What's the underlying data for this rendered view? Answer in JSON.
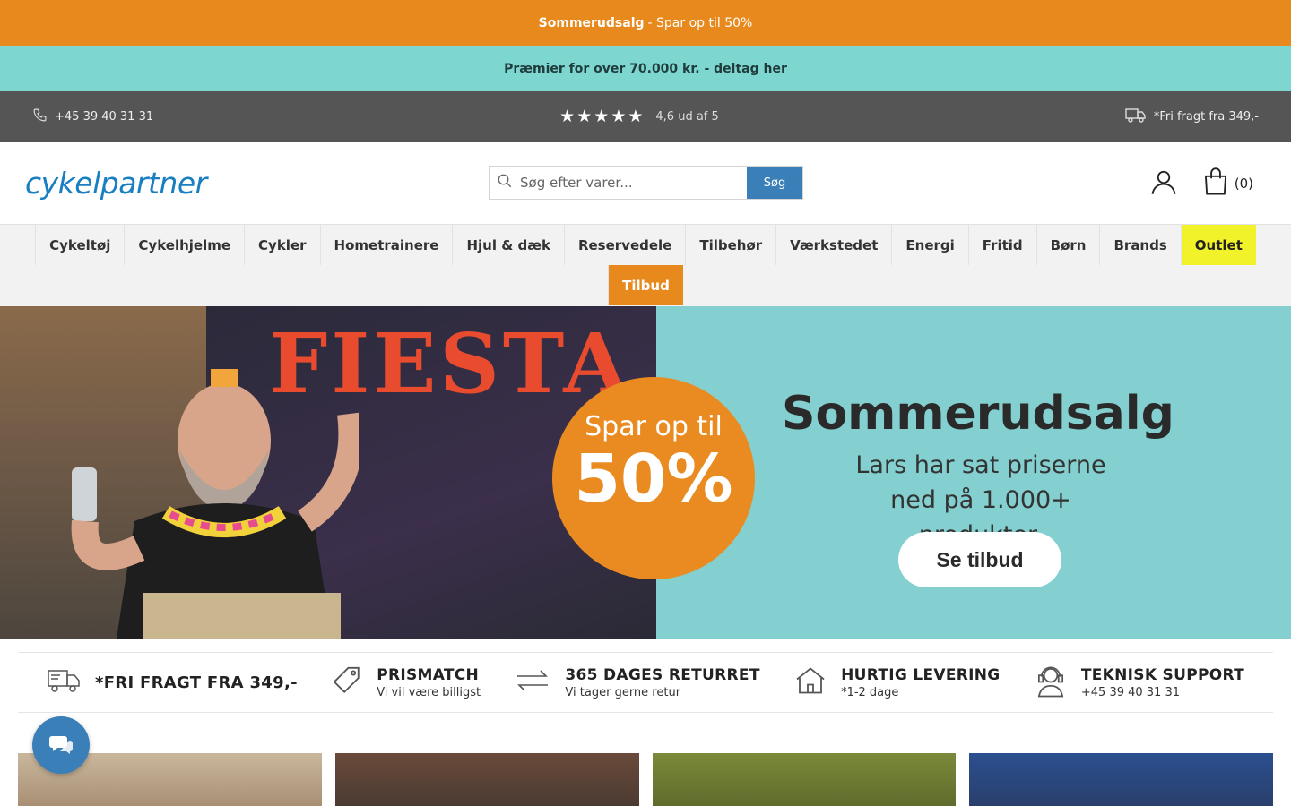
{
  "promo": {
    "bold": "Sommerudsalg",
    "text": "- Spar op til 50%"
  },
  "prize": {
    "text": "Præmier for over 70.000 kr. - deltag her"
  },
  "info": {
    "phone": "+45 39 40 31 31",
    "rating": "4,6 ud af 5",
    "shipping": "*Fri fragt fra 349,-"
  },
  "header": {
    "logo": "cykelpartner",
    "search_placeholder": "Søg efter varer...",
    "search_button": "Søg",
    "cart_count": "(0)"
  },
  "nav": {
    "items": [
      "Cykeltøj",
      "Cykelhjelme",
      "Cykler",
      "Hometrainere",
      "Hjul & dæk",
      "Reservedele",
      "Tilbehør",
      "Værkstedet",
      "Energi",
      "Fritid",
      "Børn",
      "Brands",
      "Outlet"
    ],
    "tilbud": "Tilbud"
  },
  "hero": {
    "fiesta": "FIESTA",
    "circle_small": "Spar op til",
    "circle_big": "50%",
    "title": "Sommerudsalg",
    "sub_line1": "Lars har sat priserne",
    "sub_line2": "ned på 1.000+ produkter.",
    "button": "Se tilbud"
  },
  "usp": {
    "items": [
      {
        "title": "*FRI FRAGT FRA 349,-",
        "sub": ""
      },
      {
        "title": "PRISMATCH",
        "sub": "Vi vil være billigst"
      },
      {
        "title": "365 DAGES RETURRET",
        "sub": "Vi tager gerne retur"
      },
      {
        "title": "HURTIG LEVERING",
        "sub": "*1-2 dage"
      },
      {
        "title": "TEKNISK SUPPORT",
        "sub": "+45 39 40 31 31"
      }
    ]
  }
}
